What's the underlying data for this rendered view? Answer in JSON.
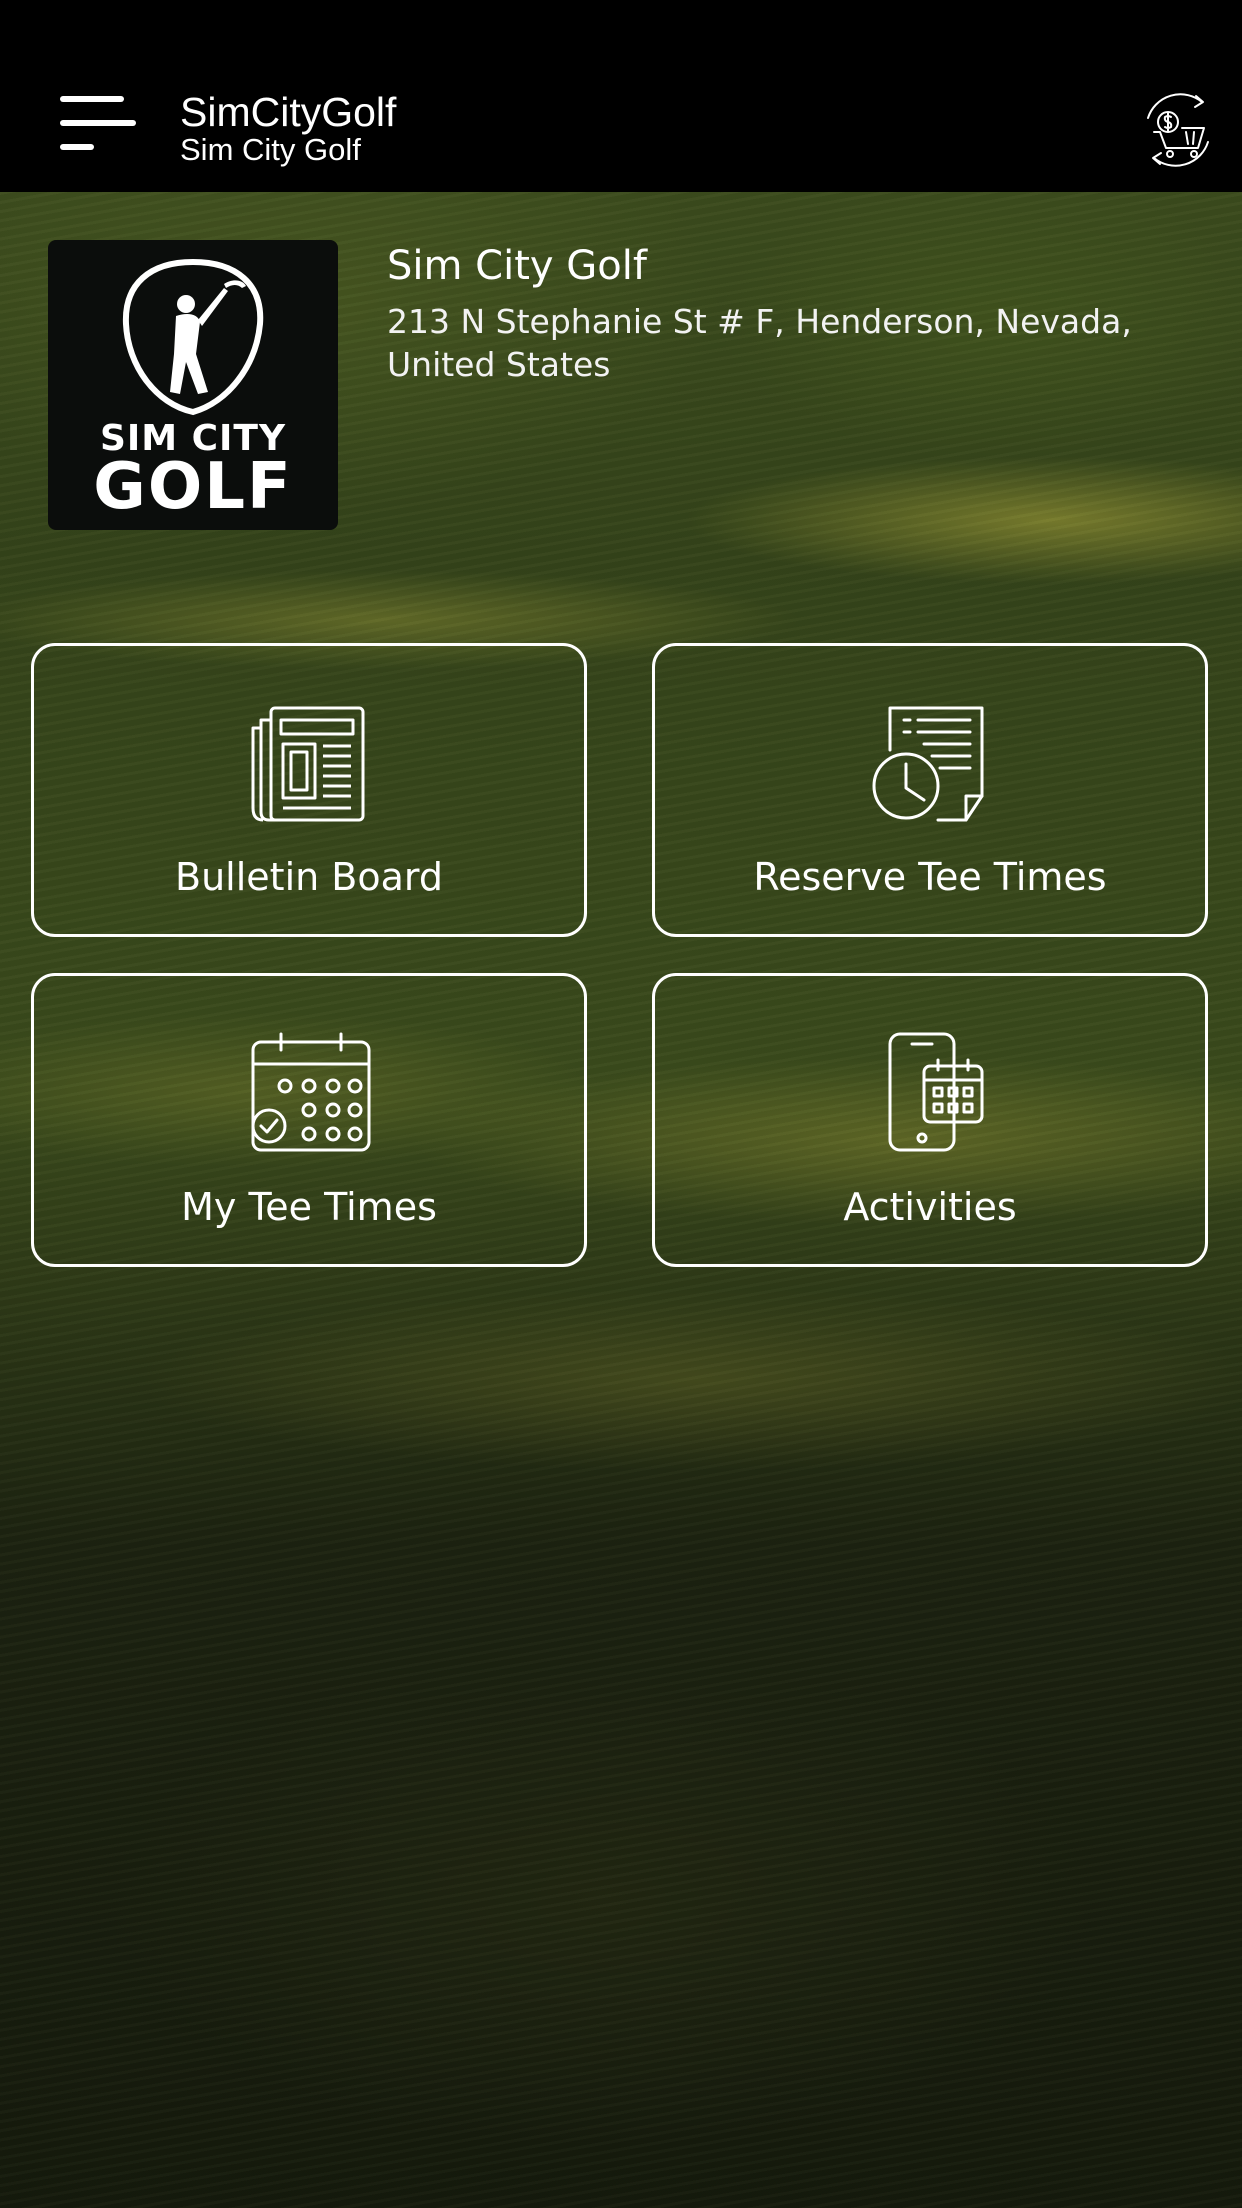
{
  "header": {
    "app_title": "SimCityGolf",
    "app_subtitle": "Sim City Golf",
    "menu_icon": "hamburger-menu-icon",
    "cart_icon": "dollar-cart-refresh-icon"
  },
  "club": {
    "logo_line_1": "SIM CITY",
    "logo_line_2": "GOLF",
    "name": "Sim City Golf",
    "address": "213 N Stephanie St # F, Henderson, Nevada, United States"
  },
  "tiles": [
    {
      "label": "Bulletin Board",
      "icon": "newspaper-icon"
    },
    {
      "label": "Reserve Tee Times",
      "icon": "document-clock-icon"
    },
    {
      "label": "My Tee Times",
      "icon": "calendar-check-icon"
    },
    {
      "label": "Activities",
      "icon": "phone-calendar-icon"
    }
  ],
  "colors": {
    "appbar": "#000000",
    "tile_border": "#ffffff",
    "text": "#ffffff",
    "background_green": "#3a4a1c"
  }
}
